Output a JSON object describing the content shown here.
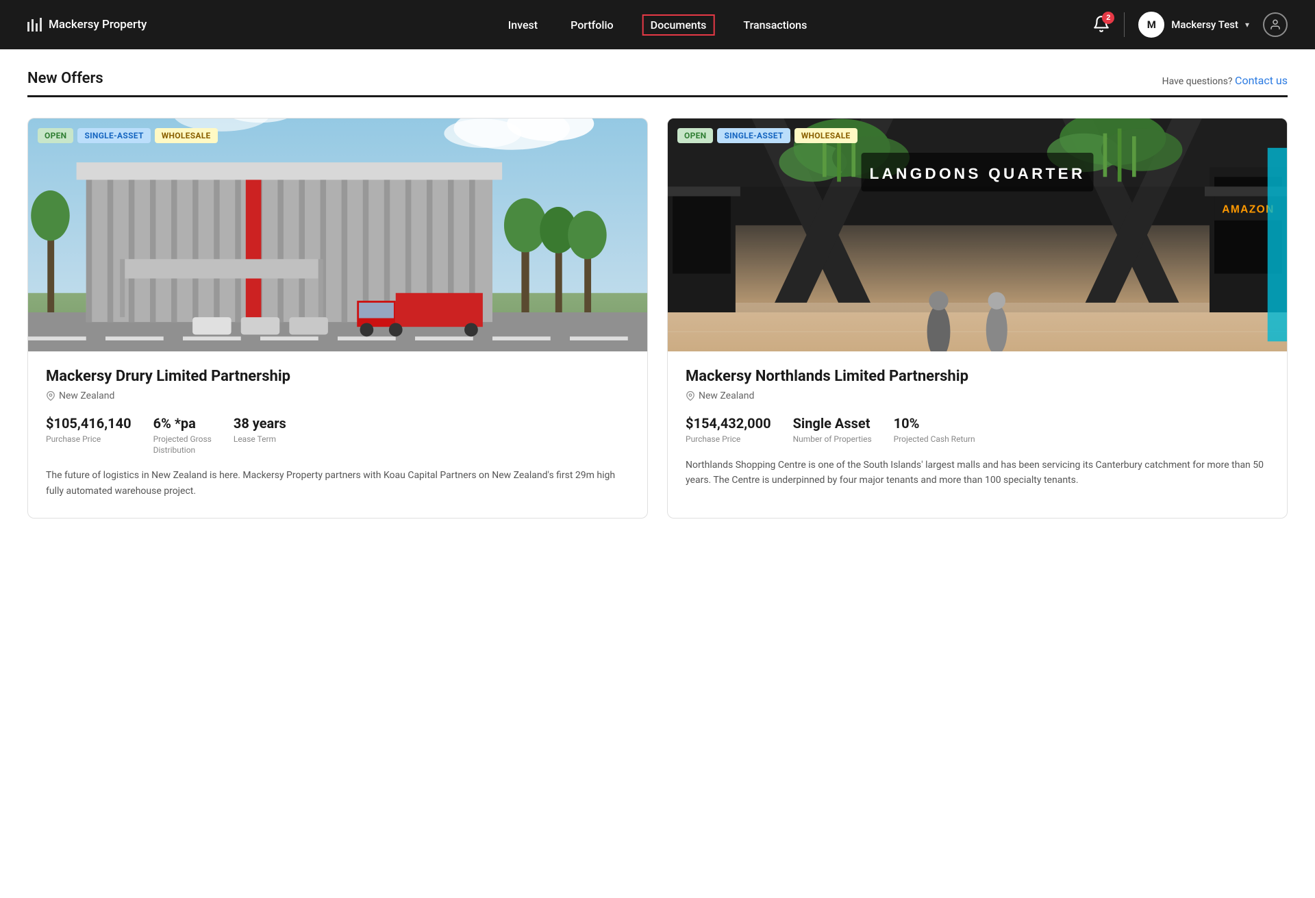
{
  "navbar": {
    "logo_text": "Mackersy Property",
    "nav_items": [
      {
        "label": "Invest",
        "active": false
      },
      {
        "label": "Portfolio",
        "active": false
      },
      {
        "label": "Documents",
        "active": true
      },
      {
        "label": "Transactions",
        "active": false
      }
    ],
    "notifications_count": "2",
    "user_initial": "M",
    "user_name": "Mackersy Test",
    "chevron": "▾"
  },
  "page": {
    "title": "New Offers",
    "contact_question": "Have questions?",
    "contact_link": "Contact us"
  },
  "cards": [
    {
      "badges": [
        "OPEN",
        "SINGLE-ASSET",
        "WHOLESALE"
      ],
      "title": "Mackersy Drury Limited Partnership",
      "location": "New Zealand",
      "stats": [
        {
          "value": "$105,416,140",
          "label": "Purchase Price"
        },
        {
          "value": "6% *pa",
          "label": "Projected Gross\nDistribution"
        },
        {
          "value": "38 years",
          "label": "Lease Term"
        }
      ],
      "description": "The future of logistics in New Zealand is here. Mackersy Property partners with Koau Capital Partners on New Zealand's first 29m high fully automated warehouse project."
    },
    {
      "badges": [
        "OPEN",
        "SINGLE-ASSET",
        "WHOLESALE"
      ],
      "title": "Mackersy Northlands Limited Partnership",
      "location": "New Zealand",
      "stats": [
        {
          "value": "$154,432,000",
          "label": "Purchase Price"
        },
        {
          "value": "Single Asset",
          "label": "Number of Properties"
        },
        {
          "value": "10%",
          "label": "Projected Cash Return"
        }
      ],
      "description": "Northlands Shopping Centre is one of the South Islands' largest malls and has been servicing its Canterbury catchment for more than 50 years. The Centre is underpinned by four major tenants and more than 100 specialty tenants."
    }
  ]
}
